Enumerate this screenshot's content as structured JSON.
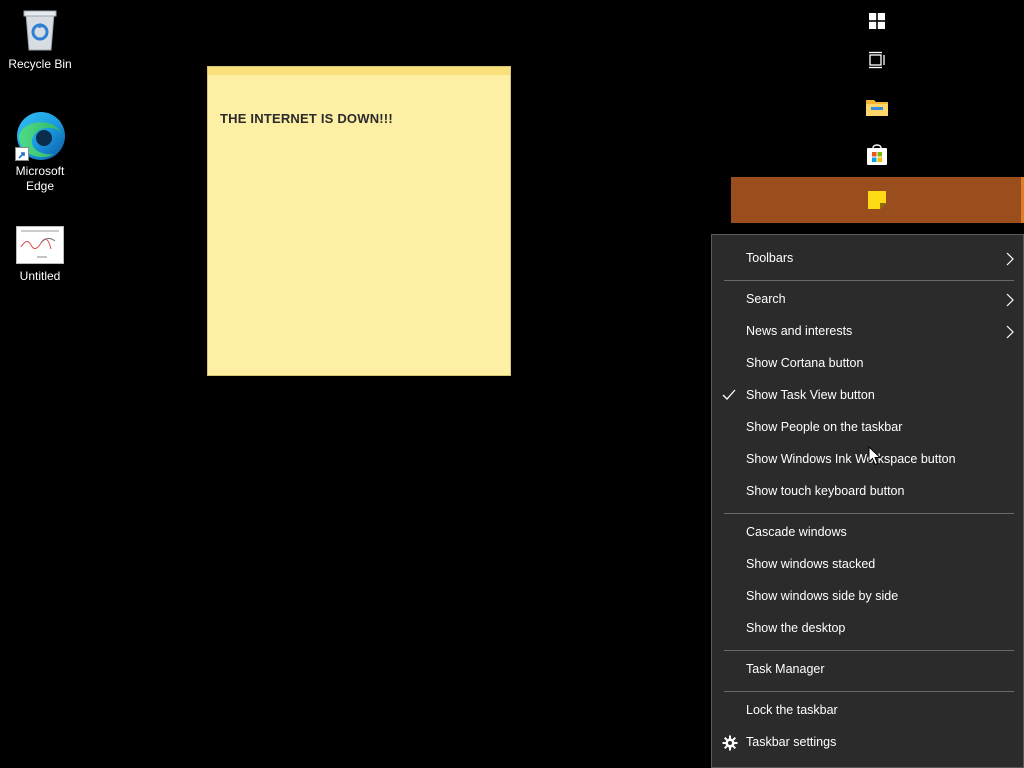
{
  "desktop": {
    "icons": [
      {
        "label": "Recycle Bin",
        "icon": "recycle-bin-icon"
      },
      {
        "label": "Microsoft Edge",
        "icon": "edge-icon"
      },
      {
        "label": "Untitled",
        "icon": "image-file-icon"
      }
    ]
  },
  "sticky_note": {
    "text": "THE INTERNET IS DOWN!!!",
    "color": "#fdf0a4"
  },
  "taskbar": {
    "orientation": "vertical-right",
    "items": [
      {
        "icon": "windows-start-icon"
      },
      {
        "icon": "task-view-icon"
      },
      {
        "icon": "file-explorer-icon"
      },
      {
        "icon": "microsoft-store-icon"
      },
      {
        "icon": "sticky-notes-icon",
        "active": true
      }
    ],
    "active_color": "#9a4e1d"
  },
  "context_menu": {
    "items": [
      {
        "label": "Toolbars",
        "submenu": true
      },
      {
        "label": "Search",
        "submenu": true
      },
      {
        "label": "News and interests",
        "submenu": true
      },
      {
        "label": "Show Cortana button"
      },
      {
        "label": "Show Task View button",
        "checked": true
      },
      {
        "label": "Show People on the taskbar"
      },
      {
        "label": "Show Windows Ink Workspace button"
      },
      {
        "label": "Show touch keyboard button"
      },
      {
        "label": "Cascade windows"
      },
      {
        "label": "Show windows stacked"
      },
      {
        "label": "Show windows side by side"
      },
      {
        "label": "Show the desktop"
      },
      {
        "label": "Task Manager"
      },
      {
        "label": "Lock the taskbar"
      },
      {
        "label": "Taskbar settings",
        "icon": "gear-icon"
      }
    ]
  }
}
